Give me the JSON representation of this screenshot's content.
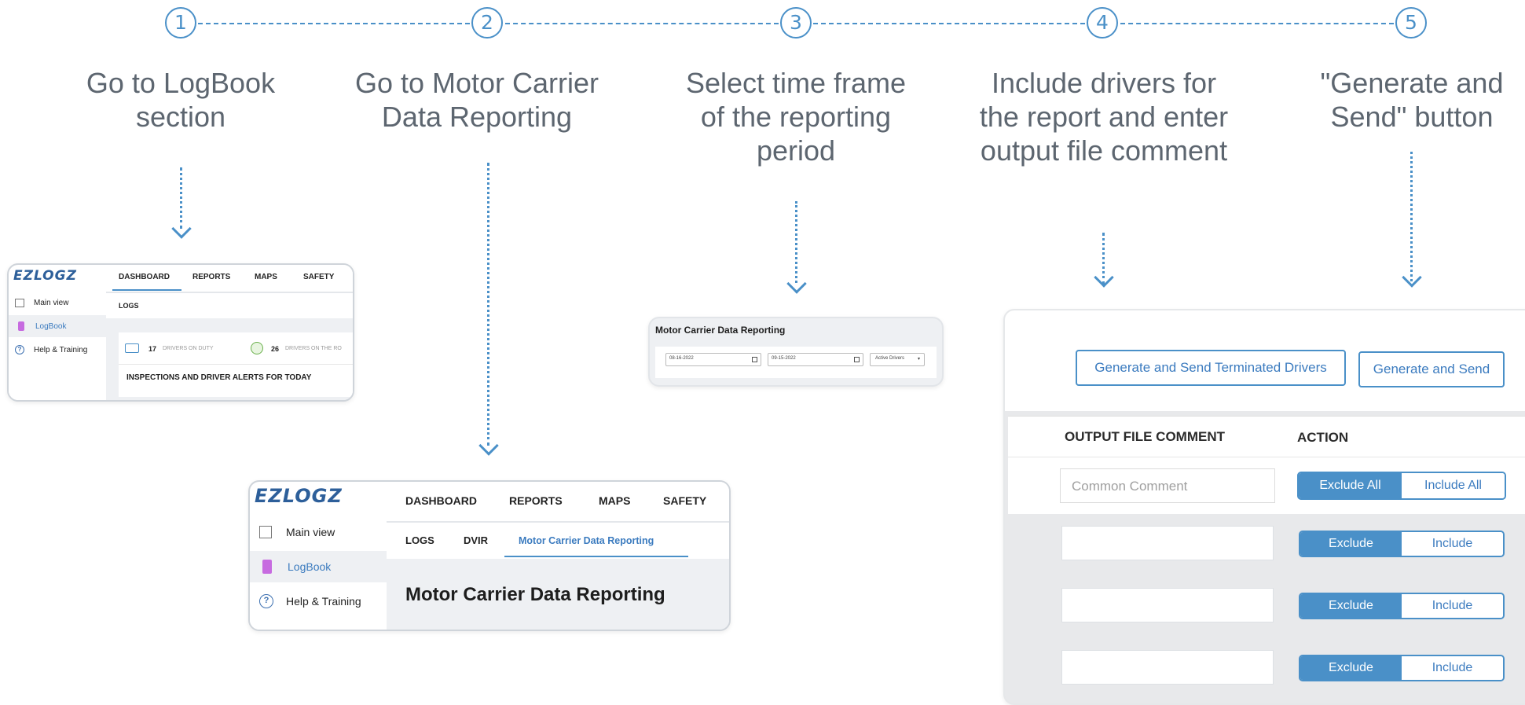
{
  "steps": [
    {
      "number": "1",
      "text": "Go to LogBook section"
    },
    {
      "number": "2",
      "text": "Go to Motor Carrier Data Reporting"
    },
    {
      "number": "3",
      "text": "Select time frame of the reporting period"
    },
    {
      "number": "4",
      "text": "Include drivers for the report and enter output file comment"
    },
    {
      "number": "5",
      "text": "\"Generate and Send\" button"
    }
  ],
  "card1": {
    "logo": "EZLOGZ",
    "nav": [
      "DASHBOARD",
      "REPORTS",
      "MAPS",
      "SAFETY"
    ],
    "sidebar": [
      "Main view",
      "LogBook",
      "Help & Training"
    ],
    "subnav": "LOGS",
    "on_duty_count": "17",
    "on_duty_label": "DRIVERS ON DUTY",
    "on_road_count": "26",
    "on_road_label": "DRIVERS ON THE RO",
    "alerts_heading": "INSPECTIONS AND DRIVER ALERTS FOR TODAY"
  },
  "card2": {
    "logo": "EZLOGZ",
    "nav": [
      "DASHBOARD",
      "REPORTS",
      "MAPS",
      "SAFETY"
    ],
    "sidebar": [
      "Main view",
      "LogBook",
      "Help & Training"
    ],
    "subnav": [
      "LOGS",
      "DVIR",
      "Motor Carrier Data Reporting"
    ],
    "heading": "Motor Carrier Data Reporting"
  },
  "card3": {
    "title": "Motor Carrier Data Reporting",
    "date_from": "08-16-2022",
    "date_to": "09-15-2022",
    "driver_filter": "Active Drivers"
  },
  "card5": {
    "btn_terminated": "Generate and Send Terminated Drivers",
    "btn_generate": "Generate and Send",
    "col_comment": "OUTPUT FILE COMMENT",
    "col_action": "ACTION",
    "common_placeholder": "Common Comment",
    "exclude_all": "Exclude All",
    "include_all": "Include All",
    "rows": [
      {
        "exclude": "Exclude",
        "include": "Include"
      },
      {
        "exclude": "Exclude",
        "include": "Include"
      },
      {
        "exclude": "Exclude",
        "include": "Include"
      }
    ]
  },
  "colors": {
    "accent": "#4a90c8",
    "step_text": "#5d6670",
    "logbook_icon": "#c76be0"
  }
}
